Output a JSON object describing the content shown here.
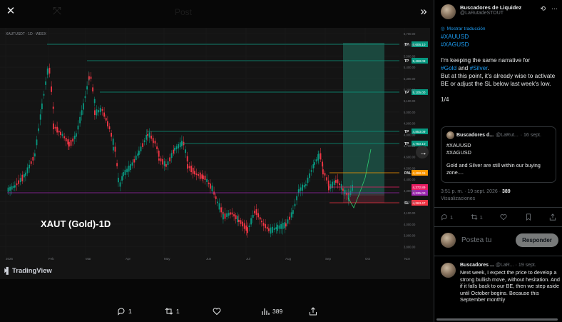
{
  "viewer": {
    "close_icon": "✕",
    "expand_icon": "⤧",
    "collapse_icon": "»",
    "bg_post_label": "Post",
    "chart": {
      "header_text": "XAUTUSDT · 1D · WEEX",
      "watermark_title": "XAUT (Gold)-1D",
      "brand": "TradingView",
      "x_labels": [
        "2026",
        "Feb",
        "Mar",
        "Apr",
        "May",
        "Jun",
        "Jul",
        "Aug",
        "Sep",
        "Oct",
        "Nov"
      ],
      "y_labels": [
        "5,700.00",
        "5,600.00",
        "5,500.00",
        "5,400.00",
        "5,300.00",
        "5,200.00",
        "5,100.00",
        "5,000.00",
        "4,900.00",
        "4,800.00",
        "4,700.00",
        "4,600.00",
        "4,500.00",
        "4,400.00",
        "4,300.00",
        "4,200.00",
        "4,100.00",
        "4,000.00",
        "3,900.00",
        "3,800.00"
      ],
      "levels": [
        {
          "tag": "TP",
          "value": "5,606.10",
          "color": "#089981"
        },
        {
          "tag": "TP",
          "value": "5,468.08",
          "color": "#089981"
        },
        {
          "tag": "TP",
          "value": "5,105.00",
          "color": "#089981"
        },
        {
          "tag": "TP",
          "value": "4,853.09",
          "color": "#089981"
        },
        {
          "tag": "TP",
          "value": "4,750.10",
          "color": "#089981"
        },
        {
          "tag": "PAL",
          "value": "4,498.45",
          "color": "#ff9800"
        },
        {
          "tag": "",
          "value": "4,372.89",
          "color": "#e91e63"
        },
        {
          "tag": "",
          "value": "4,335.00",
          "color": "#9c27b0"
        },
        {
          "tag": "SL",
          "value": "4,263.47",
          "color": "#f23645"
        }
      ],
      "accent_up": "#089981",
      "accent_down": "#f23645"
    }
  },
  "actions": {
    "reply_count": "1",
    "retweet_count": "1",
    "views_count": "389"
  },
  "author": {
    "name": "Buscadores de Liquidez",
    "handle": "@LaRutadeSTOUT"
  },
  "translate_label": "Mostrar traducción",
  "tweet": {
    "tag1": "#XAUUSD",
    "tag2": "#XAGUSD",
    "line1": "I'm keeping the same narrative for",
    "tag_gold": "#Gold",
    "and": "and",
    "tag_silver": "#Silver",
    "line2": "But at this point, it's already wise to activate BE or adjust the SL below last week's low.",
    "page": "1/4"
  },
  "quote": {
    "name": "Buscadores d...",
    "handle": "@LaRut...",
    "date": "· 16 sept.",
    "line1": "#XAUUSD",
    "line2": "#XAGUSD",
    "line3": "Gold and Silver are still within our buying zone...."
  },
  "meta": {
    "time": "3:51 p. m. · 19 sept. 2026 ·",
    "views": "389",
    "views_label": "Visualizaciones"
  },
  "stats": {
    "replies": "1",
    "retweets": "1"
  },
  "reply_box": {
    "placeholder": "Postea tu",
    "button": "Responder"
  },
  "reply2": {
    "name": "Buscadores ...",
    "handle": "@LaR...",
    "date": "· 19 sept.",
    "text": "Next week, I expect the price to develop a strong bullish move, without hesitation. And if it falls back to our BE, then we step aside until October begins. Because this September monthly"
  }
}
